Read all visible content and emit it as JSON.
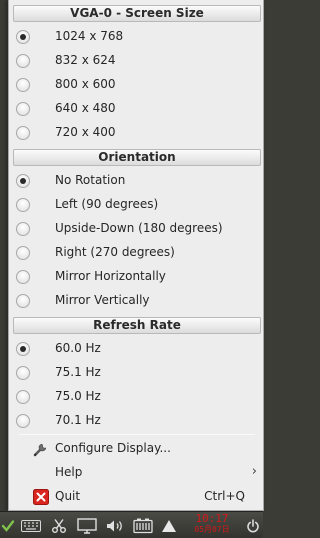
{
  "menu": {
    "screen_size": {
      "header": "VGA-0 - Screen Size",
      "options": [
        {
          "label": "1024 x 768",
          "selected": true
        },
        {
          "label": "832 x 624",
          "selected": false
        },
        {
          "label": "800 x 600",
          "selected": false
        },
        {
          "label": "640 x 480",
          "selected": false
        },
        {
          "label": "720 x 400",
          "selected": false
        }
      ]
    },
    "orientation": {
      "header": "Orientation",
      "options": [
        {
          "label": "No Rotation",
          "selected": true
        },
        {
          "label": "Left (90 degrees)",
          "selected": false
        },
        {
          "label": "Upside-Down (180 degrees)",
          "selected": false
        },
        {
          "label": "Right (270 degrees)",
          "selected": false
        },
        {
          "label": "Mirror Horizontally",
          "selected": false
        },
        {
          "label": "Mirror Vertically",
          "selected": false
        }
      ]
    },
    "refresh_rate": {
      "header": "Refresh Rate",
      "options": [
        {
          "label": "60.0 Hz",
          "selected": true
        },
        {
          "label": "75.1 Hz",
          "selected": false
        },
        {
          "label": "75.0 Hz",
          "selected": false
        },
        {
          "label": "70.1 Hz",
          "selected": false
        }
      ]
    },
    "actions": {
      "configure": {
        "label": "Configure Display...",
        "icon": "wrench-icon"
      },
      "help": {
        "label": "Help",
        "icon": "chevron-right-icon"
      },
      "quit": {
        "label": "Quit",
        "shortcut": "Ctrl+Q",
        "icon": "quit-icon",
        "icon_color": "#d9251d"
      }
    }
  },
  "taskbar": {
    "icons": [
      "check-icon",
      "keyboard-icon",
      "scissors-icon",
      "display-icon",
      "volume-icon",
      "battery-icon",
      "up-arrow-icon",
      "power-icon"
    ],
    "clock": {
      "time": "10:17",
      "date": "05月07日",
      "color": "#d21a1a"
    }
  }
}
